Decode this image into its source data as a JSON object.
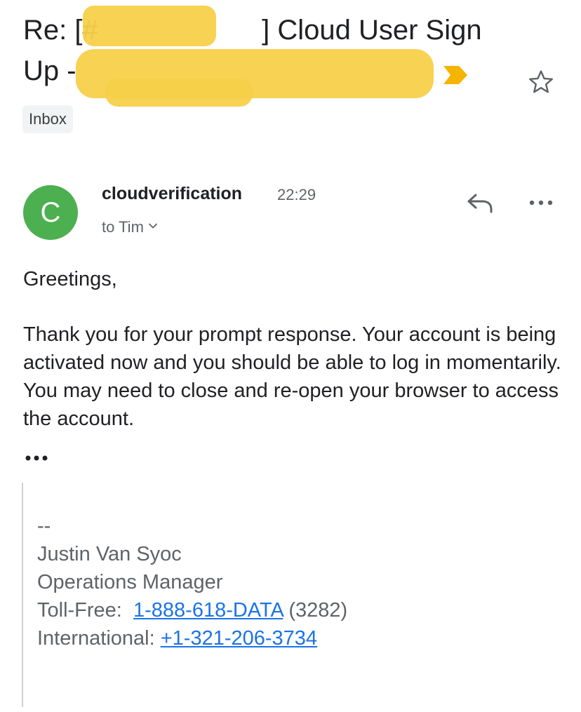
{
  "email": {
    "subject": {
      "line1_prefix": "Re: [#",
      "line1_suffix": "] Cloud User Sign",
      "line2_prefix": "Up -"
    },
    "label": "Inbox",
    "sender": {
      "avatar_letter": "C",
      "name": "cloudverification",
      "time": "22:29",
      "to": "to Tim"
    },
    "body": {
      "greeting": "Greetings,",
      "paragraph": "Thank you for your prompt response.  Your account is being activated now and you should be able to log in momentarily.  You may need to close and re-open your browser to access the account."
    },
    "signature": {
      "dashes": "--",
      "name": "Justin Van Syoc",
      "title": "Operations Manager",
      "toll_free_label": "Toll-Free:",
      "toll_free_number": "1-888-618-DATA",
      "toll_free_digits": "(3282)",
      "international_label": "International:",
      "international_number": "+1-321-206-3734"
    }
  },
  "icons": {
    "important": "important-marker-icon",
    "star": "star-icon",
    "reply": "reply-icon",
    "more": "more-options-icon",
    "show_trimmed": "ellipsis-icon",
    "recipient_details": "chevron-down-icon"
  },
  "colors": {
    "avatar": "#4caf50",
    "important_marker": "#f4b400",
    "link": "#1a73e8",
    "label_chip": "#f1f3f4"
  }
}
